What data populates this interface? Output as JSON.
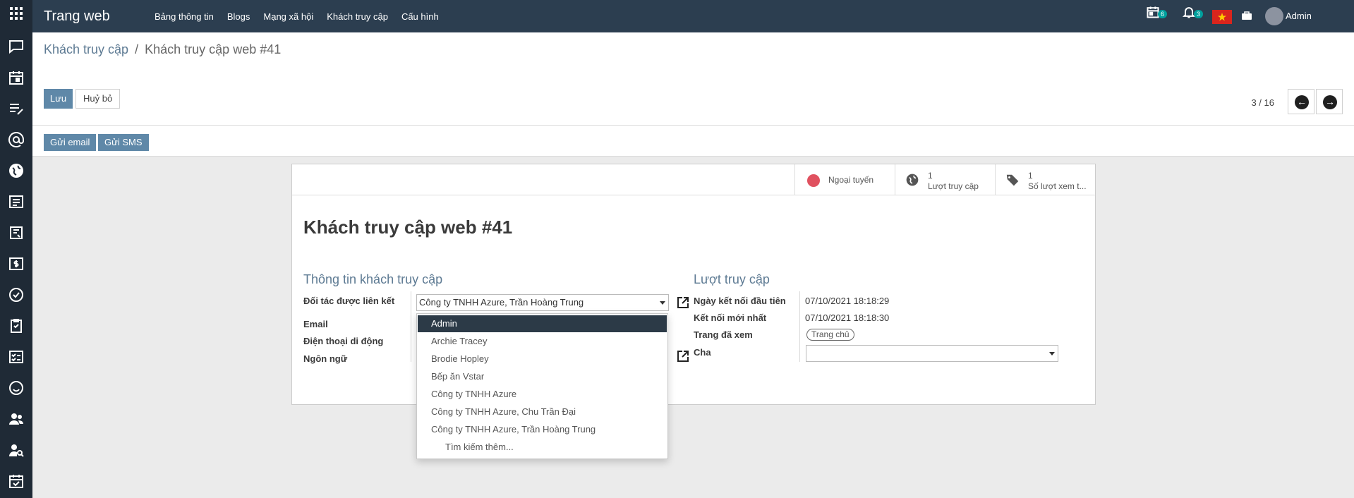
{
  "navbar": {
    "brand": "Trang web",
    "menu": [
      "Bảng thông tin",
      "Blogs",
      "Mạng xã hội",
      "Khách truy cập",
      "Cấu hình"
    ],
    "calendar_count": "6",
    "notification_count": "3",
    "user": "Admin"
  },
  "rail_icons": [
    "discuss-icon",
    "calendar-icon",
    "notes-icon",
    "email-marketing-icon",
    "website-icon",
    "blog-icon",
    "invoicing-icon",
    "accounting-icon",
    "project-icon",
    "clipboard-icon",
    "survey-icon",
    "smiley-icon",
    "contacts-icon",
    "employees-icon",
    "approvals-icon"
  ],
  "breadcrumb": {
    "parent": "Khách truy cập",
    "separator": "/",
    "current": "Khách truy cập web #41"
  },
  "buttons": {
    "save": "Lưu",
    "discard": "Huỷ bỏ",
    "send_email": "Gửi email",
    "send_sms": "Gửi SMS"
  },
  "pager": {
    "text": "3 / 16"
  },
  "smart_buttons": {
    "status": "Ngoại tuyến",
    "visits_count": "1",
    "visits_label": "Lượt truy cập",
    "pages_count": "1",
    "pages_label": "Số lượt xem t..."
  },
  "colors": {
    "status_offline": "#e0515f",
    "accent": "#5f88a8",
    "navbar": "#2c3e50"
  },
  "form": {
    "title": "Khách truy cập web #41",
    "left_group": {
      "title": "Thông tin khách truy cập",
      "partner_label": "Đối tác được liên kết",
      "partner_value": "Công ty TNHH Azure, Trần Hoàng Trung",
      "email_label": "Email",
      "mobile_label": "Điện thoại di động",
      "language_label": "Ngôn ngữ"
    },
    "right_group": {
      "title": "Lượt truy cập",
      "first_connection_label": "Ngày kết nối đầu tiên",
      "first_connection_value": "07/10/2021 18:18:29",
      "last_connection_label": "Kết nối mới nhất",
      "last_connection_value": "07/10/2021 18:18:30",
      "pages_label": "Trang đã xem",
      "pages_tag": "Trang chủ",
      "parent_label": "Cha",
      "parent_value": ""
    }
  },
  "dropdown": {
    "items": [
      "Admin",
      "Archie Tracey",
      "Brodie Hopley",
      "Bếp ăn Vstar",
      "Công ty TNHH Azure",
      "Công ty TNHH Azure, Chu Trần Đại",
      "Công ty TNHH Azure, Trần Hoàng Trung"
    ],
    "more": "Tìm kiếm thêm..."
  }
}
